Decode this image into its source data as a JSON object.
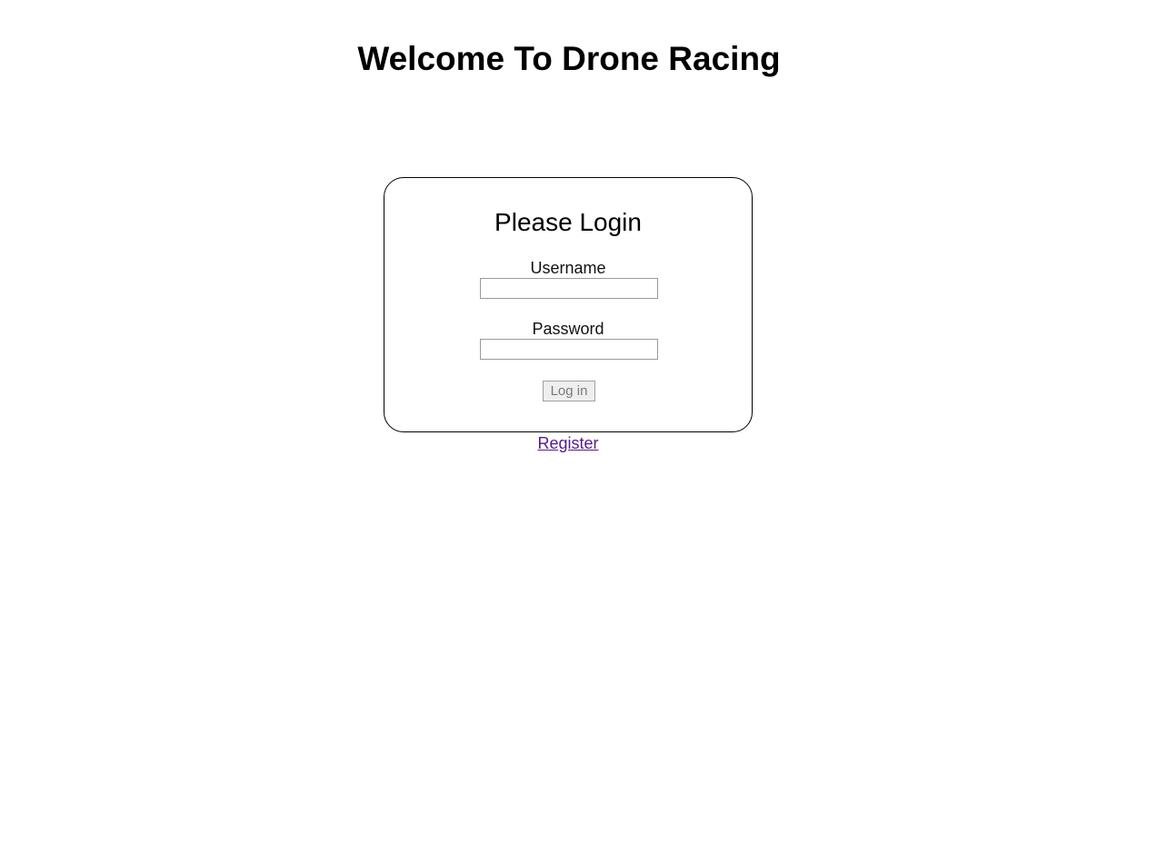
{
  "header": {
    "title": "Welcome To Drone Racing"
  },
  "login": {
    "title": "Please Login",
    "username_label": "Username",
    "username_value": "",
    "password_label": "Password",
    "password_value": "",
    "submit_label": "Log in"
  },
  "register": {
    "label": "Register"
  },
  "colors": {
    "link_visited": "#551a8b",
    "card_border": "#000000",
    "button_bg": "#eeeeee"
  }
}
